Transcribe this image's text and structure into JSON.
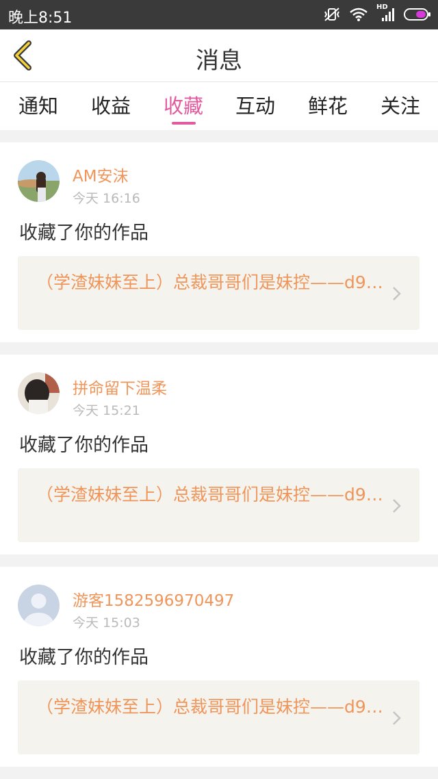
{
  "status_bar": {
    "time": "晚上8:51",
    "network_label": "HD"
  },
  "header": {
    "title": "消息"
  },
  "tabs": [
    {
      "label": "通知"
    },
    {
      "label": "收益"
    },
    {
      "label": "收藏"
    },
    {
      "label": "互动"
    },
    {
      "label": "鲜花"
    },
    {
      "label": "关注"
    }
  ],
  "active_tab": "收藏",
  "colors": {
    "accent_pink": "#e25b9f",
    "accent_orange": "#f0955a",
    "status_bar": "#3a3a3a",
    "battery": "#d63ad8"
  },
  "messages": [
    {
      "username": "AM安沫",
      "time": "今天 16:16",
      "action": "收藏了你的作品",
      "work_title": "（学渣妹妹至上）总裁哥哥们是妹控——d9…",
      "avatar": "photo-avatar"
    },
    {
      "username": "拼命留下温柔",
      "time": "今天 15:21",
      "action": "收藏了你的作品",
      "work_title": "（学渣妹妹至上）总裁哥哥们是妹控——d9…",
      "avatar": "photo-avatar"
    },
    {
      "username": "游客1582596970497",
      "time": "今天 15:03",
      "action": "收藏了你的作品",
      "work_title": "（学渣妹妹至上）总裁哥哥们是妹控——d9…",
      "avatar": "default-user-avatar"
    }
  ]
}
